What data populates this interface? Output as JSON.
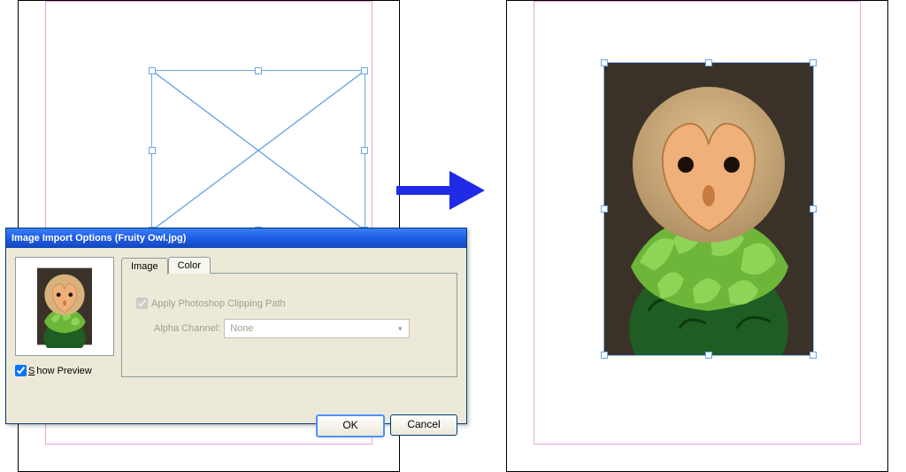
{
  "dialog": {
    "title": "Image Import Options (Fruity Owl.jpg)",
    "show_preview_label": "Show Preview",
    "show_preview_checked": true,
    "tabs": {
      "image": "Image",
      "color": "Color"
    },
    "apply_clipping_label": "Apply Photoshop Clipping Path",
    "apply_clipping_checked": true,
    "alpha_label": "Alpha Channel:",
    "alpha_value": "None",
    "ok_label": "OK",
    "cancel_label": "Cancel"
  }
}
